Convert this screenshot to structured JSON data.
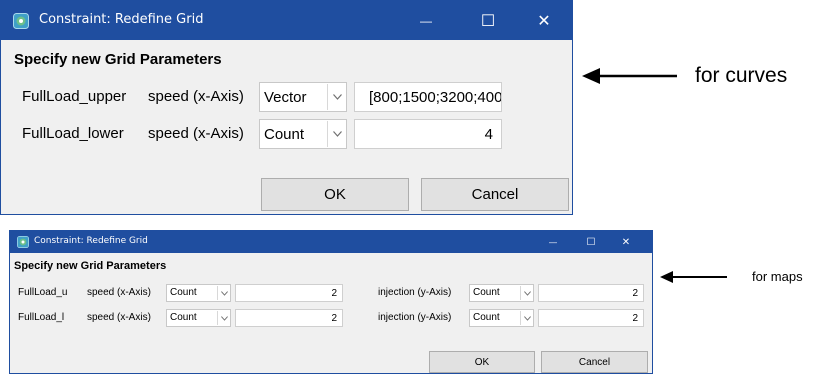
{
  "curves_dialog": {
    "title": "Constraint: Redefine Grid",
    "heading": "Specify new Grid Parameters",
    "rows": [
      {
        "name": "FullLoad_upper",
        "axis_label": "speed (x-Axis)",
        "mode": "Vector",
        "value": "[800;1500;3200;400"
      },
      {
        "name": "FullLoad_lower",
        "axis_label": "speed (x-Axis)",
        "mode": "Count",
        "value": "4"
      }
    ],
    "ok_label": "OK",
    "cancel_label": "Cancel"
  },
  "maps_dialog": {
    "title": "Constraint: Redefine Grid",
    "heading": "Specify new Grid Parameters",
    "rows": [
      {
        "name": "FullLoad_u",
        "x_label": "speed (x-Axis)",
        "x_mode": "Count",
        "x_value": "2",
        "y_label": "injection (y-Axis)",
        "y_mode": "Count",
        "y_value": "2"
      },
      {
        "name": "FullLoad_l",
        "x_label": "speed (x-Axis)",
        "x_mode": "Count",
        "x_value": "2",
        "y_label": "injection (y-Axis)",
        "y_mode": "Count",
        "y_value": "2"
      }
    ],
    "ok_label": "OK",
    "cancel_label": "Cancel"
  },
  "annotations": {
    "curves": "for curves",
    "maps": "for maps"
  },
  "window_controls": {
    "minimize": "—",
    "maximize": "☐",
    "close": "✕"
  },
  "colors": {
    "titlebar": "#1f4ea0",
    "dialog_bg": "#f0f0f0",
    "button_bg": "#e1e1e1"
  },
  "icons": [
    "app-icon",
    "dropdown-arrow-icon",
    "minimize-icon",
    "maximize-icon",
    "close-icon",
    "annotation-arrow"
  ]
}
